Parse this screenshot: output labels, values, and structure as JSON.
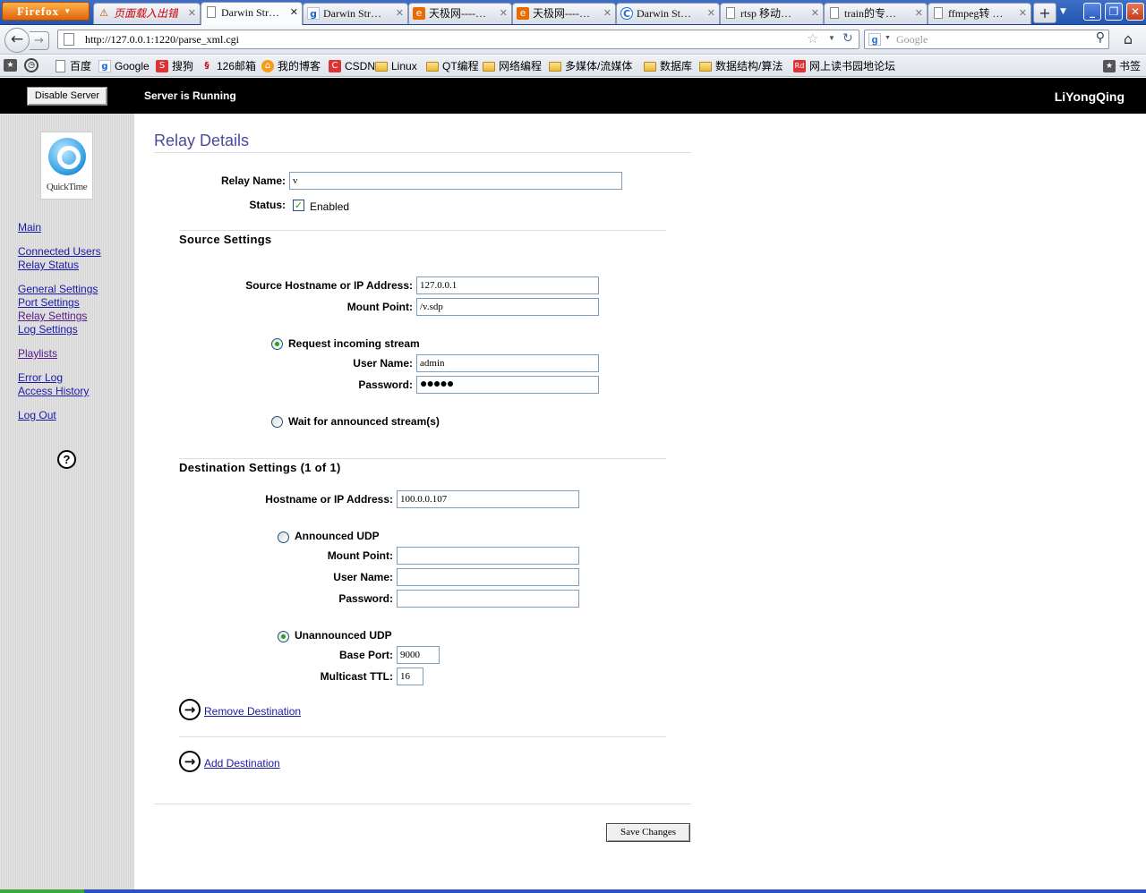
{
  "browser": {
    "app_button": "Firefox",
    "tabs": [
      {
        "label": "页面载入出错",
        "icon": "warning-icon"
      },
      {
        "label": "Darwin Str…",
        "icon": "page-icon",
        "active": true
      },
      {
        "label": "Darwin Str…",
        "icon": "google-icon"
      },
      {
        "label": "天极网----…",
        "icon": "tianji-icon"
      },
      {
        "label": "天极网----…",
        "icon": "tianji-icon"
      },
      {
        "label": "Darwin  St…",
        "icon": "chrome-c-icon"
      },
      {
        "label": "rtsp 移动…",
        "icon": "page-icon"
      },
      {
        "label": "train的专…",
        "icon": "page-icon"
      },
      {
        "label": "ffmpeg转 …",
        "icon": "page-icon"
      }
    ],
    "url": "http://127.0.0.1:1220/parse_xml.cgi",
    "search_placeholder": "Google",
    "bookmarks": [
      {
        "label": "百度",
        "icon": "page-icon"
      },
      {
        "label": "Google",
        "icon": "google-icon"
      },
      {
        "label": "搜狗",
        "icon": "sogou-icon"
      },
      {
        "label": "126邮箱",
        "icon": "mail126-icon"
      },
      {
        "label": "我的博客",
        "icon": "blog-icon"
      },
      {
        "label": "CSDN",
        "icon": "csdn-icon"
      },
      {
        "label": "Linux",
        "icon": "folder-icon"
      },
      {
        "label": "QT编程",
        "icon": "folder-icon"
      },
      {
        "label": "网络编程",
        "icon": "folder-icon"
      },
      {
        "label": "多媒体/流媒体",
        "icon": "folder-icon"
      },
      {
        "label": "数据库",
        "icon": "folder-icon"
      },
      {
        "label": "数据结构/算法",
        "icon": "folder-icon"
      },
      {
        "label": "网上读书园地论坛",
        "icon": "rd-icon"
      }
    ],
    "bookmarks_menu": "书签"
  },
  "topbar": {
    "disable_button": "Disable Server",
    "status": "Server is Running",
    "user": "LiYongQing"
  },
  "sidebar": {
    "logo_text": "QuickTime",
    "links": {
      "main": "Main",
      "connected_users": "Connected Users",
      "relay_status": "Relay Status",
      "general_settings": "General Settings",
      "port_settings": "Port Settings",
      "relay_settings": "Relay Settings",
      "log_settings": "Log Settings",
      "playlists": "Playlists",
      "error_log": "Error Log",
      "access_history": "Access History",
      "log_out": "Log Out"
    },
    "help": "?"
  },
  "relay": {
    "title": "Relay Details",
    "name_label": "Relay Name:",
    "name_value": "v",
    "status_label": "Status:",
    "enabled_label": "Enabled",
    "enabled": true
  },
  "source": {
    "heading": "Source Settings",
    "host_label": "Source Hostname or IP Address:",
    "host_value": "127.0.0.1",
    "mount_label": "Mount Point:",
    "mount_value": "/v.sdp",
    "request_label": "Request incoming stream",
    "request_selected": true,
    "user_label": "User Name:",
    "user_value": "admin",
    "password_label": "Password:",
    "password_value": "●●●●●",
    "wait_label": "Wait for announced stream(s)",
    "wait_selected": false
  },
  "destination": {
    "heading": "Destination Settings (1 of 1)",
    "host_label": "Hostname or IP Address:",
    "host_value": "100.0.0.107",
    "announced_label": "Announced UDP",
    "announced_selected": false,
    "mount_label": "Mount Point:",
    "mount_value": "",
    "user_label": "User Name:",
    "user_value": "",
    "password_label": "Password:",
    "password_value": "",
    "unannounced_label": "Unannounced UDP",
    "unannounced_selected": true,
    "base_port_label": "Base Port:",
    "base_port_value": "9000",
    "ttl_label": "Multicast TTL:",
    "ttl_value": "16",
    "remove_link": "Remove Destination",
    "add_link": "Add Destination"
  },
  "save_button": "Save Changes"
}
